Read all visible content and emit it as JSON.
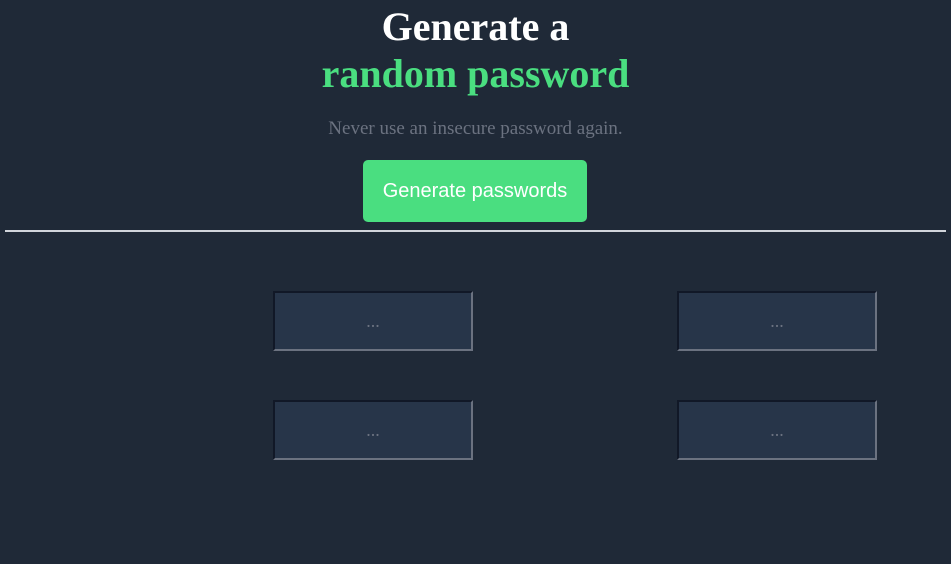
{
  "header": {
    "title_line1": "Generate a",
    "title_line2": "random password",
    "subtitle": "Never use an insecure password again."
  },
  "actions": {
    "generate_label": "Generate passwords"
  },
  "passwords": [
    {
      "value": "..."
    },
    {
      "value": "..."
    },
    {
      "value": "..."
    },
    {
      "value": "..."
    }
  ],
  "colors": {
    "background": "#1f2937",
    "accent": "#4ade80",
    "muted_text": "#6b7280",
    "box_background": "#273549"
  }
}
